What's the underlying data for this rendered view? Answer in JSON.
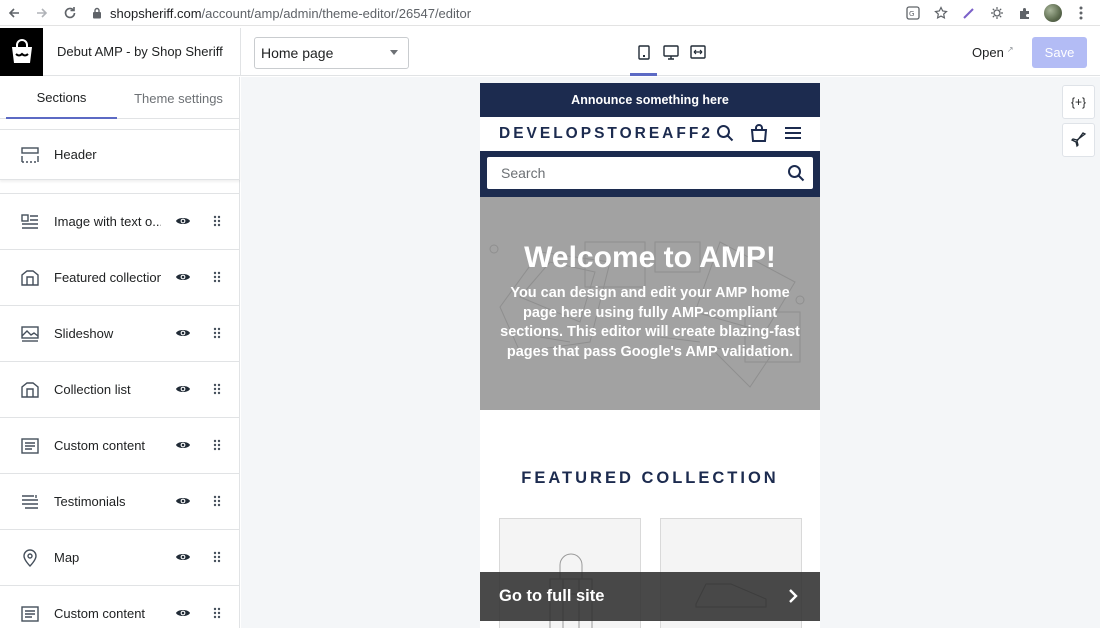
{
  "browser": {
    "url_host": "shopsheriff.com",
    "url_path": "/account/amp/admin/theme-editor/26547/editor"
  },
  "header": {
    "theme_name": "Debut AMP - by Shop Sheriff",
    "page_select": "Home page",
    "open_label": "Open",
    "save_label": "Save"
  },
  "sidebar": {
    "tabs": [
      "Sections",
      "Theme settings"
    ],
    "header_section": "Header",
    "sections": [
      {
        "label": "Image with text o...",
        "icon": "image-text-icon"
      },
      {
        "label": "Featured collection",
        "icon": "collection-icon"
      },
      {
        "label": "Slideshow",
        "icon": "slideshow-icon"
      },
      {
        "label": "Collection list",
        "icon": "collection-icon"
      },
      {
        "label": "Custom content",
        "icon": "custom-content-icon"
      },
      {
        "label": "Testimonials",
        "icon": "testimonials-icon"
      },
      {
        "label": "Map",
        "icon": "map-pin-icon"
      },
      {
        "label": "Custom content",
        "icon": "custom-content-icon"
      }
    ]
  },
  "preview": {
    "announcement": "Announce something here",
    "store_name": "DEVELOPSTOREAFF2",
    "search_placeholder": "Search",
    "hero_title": "Welcome to AMP!",
    "hero_text": "You can design and edit your AMP home page here using fully AMP-compliant sections. This editor will create blazing-fast pages that pass Google's AMP validation.",
    "featured_title": "FEATURED COLLECTION",
    "full_site": "Go to full site"
  },
  "tools": {
    "liquid_label": "{+}"
  },
  "colors": {
    "accent": "#5c6ac4",
    "save_disabled": "#b3bcf5",
    "store_navy": "#1c2b4f",
    "hero_gray": "#a2a2a2"
  }
}
